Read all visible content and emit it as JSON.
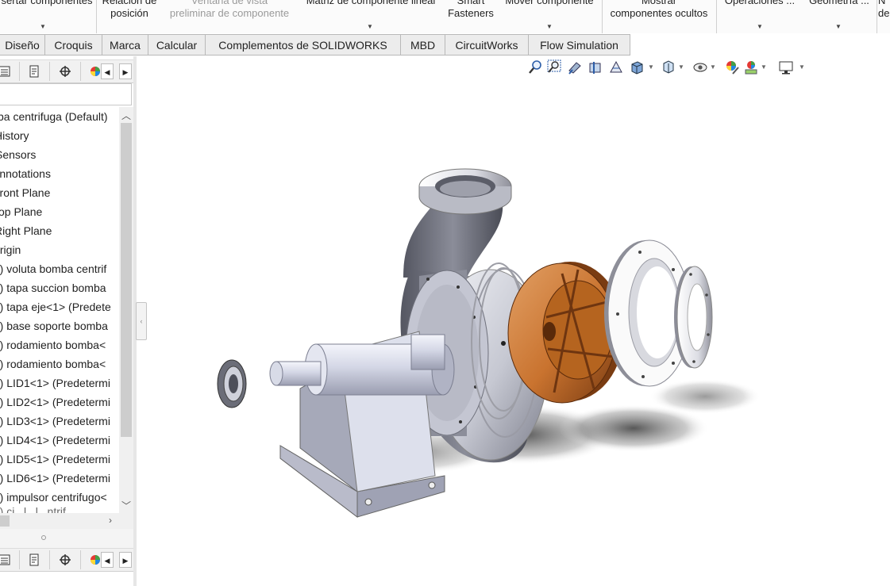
{
  "ribbon": {
    "items": [
      {
        "l1": "sertar componentes",
        "l2": "",
        "arrow": true,
        "disabled": false
      },
      {
        "l1": "Relación de",
        "l2": "posición",
        "arrow": false,
        "disabled": false
      },
      {
        "l1": "Ventana de vista",
        "l2": "preliminar de componente",
        "arrow": false,
        "disabled": true
      },
      {
        "l1": "Matriz de componente lineal",
        "l2": "",
        "arrow": true,
        "disabled": false
      },
      {
        "l1": "Smart",
        "l2": "Fasteners",
        "arrow": false,
        "disabled": false
      },
      {
        "l1": "Mover componente",
        "l2": "",
        "arrow": true,
        "disabled": false
      },
      {
        "l1": "Mostrar",
        "l2": "componentes ocultos",
        "arrow": false,
        "disabled": false
      },
      {
        "l1": "Operaciones ...",
        "l2": "",
        "arrow": true,
        "disabled": false
      },
      {
        "l1": "Geometría ...",
        "l2": "",
        "arrow": true,
        "disabled": false
      },
      {
        "l1": "N",
        "l2": "de",
        "arrow": false,
        "disabled": false
      }
    ]
  },
  "tabs": [
    "Diseño",
    "Croquis",
    "Marca",
    "Calcular",
    "Complementos de SOLIDWORKS",
    "MBD",
    "CircuitWorks",
    "Flow Simulation"
  ],
  "tree": {
    "items": [
      "ba centrifuga  (Default)",
      "History",
      "Sensors",
      "Annotations",
      "Front Plane",
      "Top Plane",
      "Right Plane",
      "Origin",
      "-) voluta bomba centrif",
      "-) tapa succion bomba",
      "-) tapa eje<1> (Predete",
      "-) base soporte bomba",
      "-) rodamiento bomba<",
      "-) rodamiento bomba<",
      "-) LID1<1> (Predetermi",
      "-) LID2<1> (Predetermi",
      "-) LID3<1> (Predetermi",
      "-) LID4<1> (Predetermi",
      "-) LID5<1> (Predetermi",
      "-) LID6<1> (Predetermi",
      "-) impulsor centrifugo<",
      "-) ci...l...l...ntrif..."
    ]
  },
  "panel_icons": [
    "feature-manager-icon",
    "property-manager-icon",
    "configuration-manager-icon",
    "appearance-icon"
  ],
  "view_tools": [
    "zoom-to-fit-icon",
    "zoom-to-area-icon",
    "previous-view-icon",
    "section-view-icon",
    "dynamic-annotation-icon",
    "view-orientation-icon",
    "display-style-icon",
    "hide-show-items-icon",
    "edit-appearance-icon",
    "apply-scene-icon",
    "view-settings-icon"
  ],
  "colors": {
    "ribbon_bg": "#fbfbfb",
    "tab_bg": "#ececec",
    "impeller": "#c9732f",
    "steel": "#c8cad6"
  }
}
